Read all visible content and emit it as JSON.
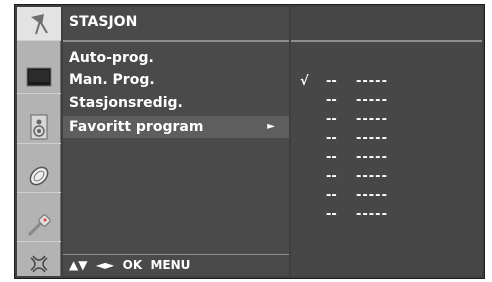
{
  "menu": {
    "title": "STASJON",
    "items": [
      {
        "label": "Auto-prog.",
        "arrow": ""
      },
      {
        "label": "Man. Prog.",
        "arrow": ""
      },
      {
        "label": "Stasjonsredig.",
        "arrow": ""
      },
      {
        "label": "Favoritt program",
        "arrow": "►"
      }
    ],
    "footer": "▲▼  ◄►  OK  MENU"
  },
  "sidebar": {
    "icons": [
      "antenna-icon",
      "picture-icon",
      "speaker-icon",
      "clock-icon",
      "key-icon",
      "settings-icon"
    ],
    "active_index": 0
  },
  "favorites": [
    {
      "check": "√",
      "number": "--",
      "name": "-----"
    },
    {
      "check": "",
      "number": "--",
      "name": "-----"
    },
    {
      "check": "",
      "number": "--",
      "name": "-----"
    },
    {
      "check": "",
      "number": "--",
      "name": "-----"
    },
    {
      "check": "",
      "number": "--",
      "name": "-----"
    },
    {
      "check": "",
      "number": "--",
      "name": "-----"
    },
    {
      "check": "",
      "number": "--",
      "name": "-----"
    },
    {
      "check": "",
      "number": "--",
      "name": "-----"
    }
  ]
}
